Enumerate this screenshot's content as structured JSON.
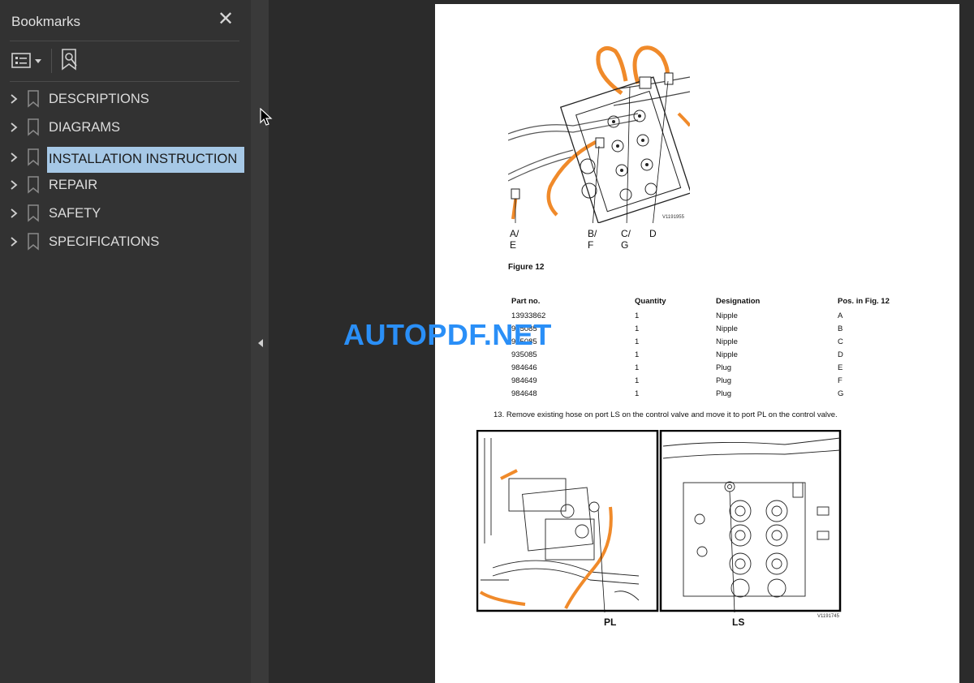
{
  "sidebar": {
    "title": "Bookmarks",
    "items": [
      {
        "label": "DESCRIPTIONS"
      },
      {
        "label": "DIAGRAMS"
      },
      {
        "label": "INSTALLATION INSTRUCTION",
        "selected": true
      },
      {
        "label": "REPAIR"
      },
      {
        "label": "SAFETY"
      },
      {
        "label": "SPECIFICATIONS"
      }
    ]
  },
  "document": {
    "figure1": {
      "callouts": [
        "A/\nE",
        "B/\nF",
        "C/\nG",
        "D"
      ],
      "image_id": "V1191955",
      "caption": "Figure 12"
    },
    "parts_table": {
      "headers": [
        "Part no.",
        "Quantity",
        "Designation",
        "Pos. in Fig. 12"
      ],
      "rows": [
        [
          "13933862",
          "1",
          "Nipple",
          "A"
        ],
        [
          "935085",
          "1",
          "Nipple",
          "B"
        ],
        [
          "935085",
          "1",
          "Nipple",
          "C"
        ],
        [
          "935085",
          "1",
          "Nipple",
          "D"
        ],
        [
          "984646",
          "1",
          "Plug",
          "E"
        ],
        [
          "984649",
          "1",
          "Plug",
          "F"
        ],
        [
          "984648",
          "1",
          "Plug",
          "G"
        ]
      ]
    },
    "step13": "13.   Remove existing hose on port LS on the control valve and move it to port PL on the control valve.",
    "figure2": {
      "label_left": "PL",
      "label_right": "LS",
      "image_id": "V1191745"
    }
  },
  "watermark": "AUTOPDF.NET",
  "colors": {
    "sidebar_bg": "#323232",
    "selected_bg": "#a6c8e6",
    "viewer_bg": "#2b2b2b",
    "hose_orange": "#f08a2a",
    "watermark": "#2a8ff7"
  }
}
